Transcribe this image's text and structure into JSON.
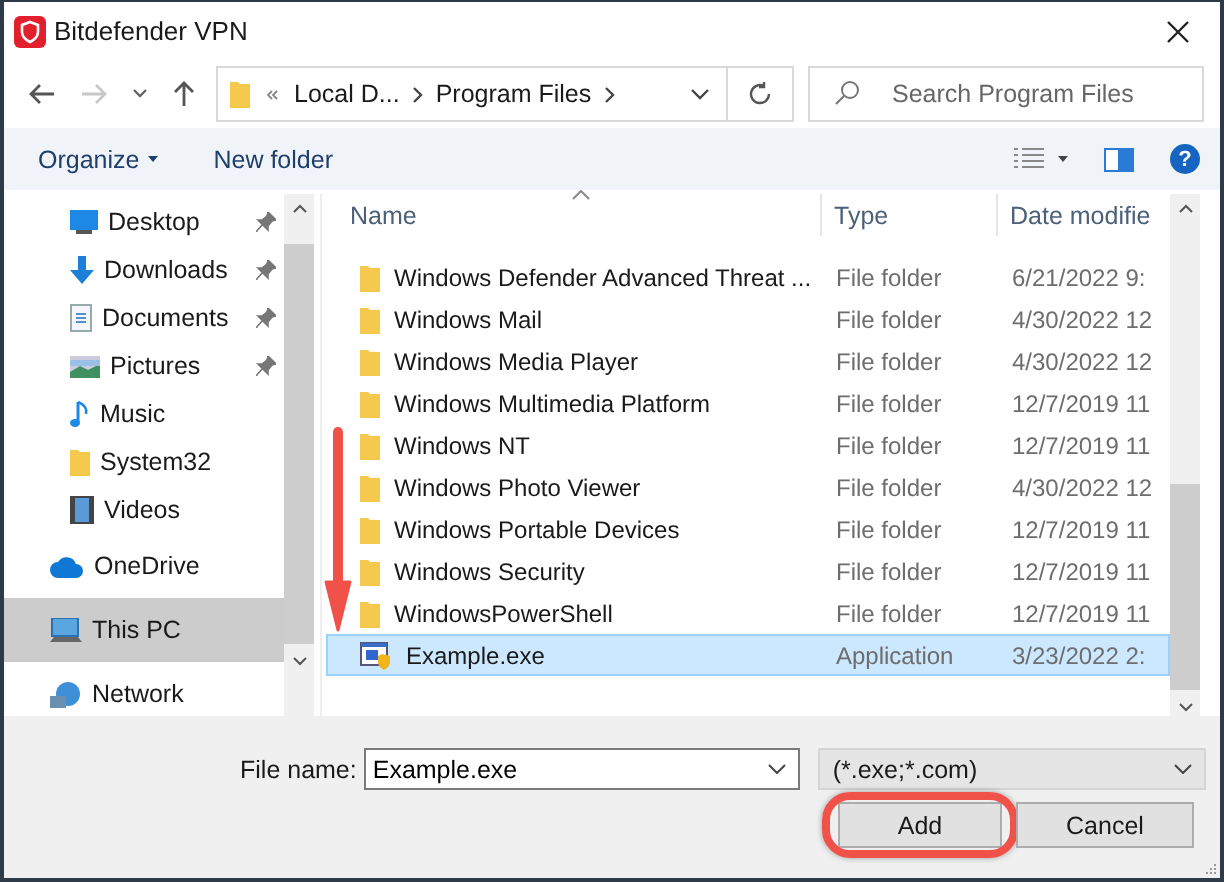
{
  "window": {
    "title": "Bitdefender VPN"
  },
  "nav": {
    "forward_disabled": true,
    "breadcrumb": [
      "Local D...",
      "Program Files"
    ],
    "search": {
      "placeholder": "Search Program Files"
    }
  },
  "toolbar": {
    "organize": "Organize",
    "new_folder": "New folder",
    "help": "?"
  },
  "sidebar": {
    "items": [
      {
        "label": "Desktop",
        "kind": "desktop",
        "pinned": true,
        "selected": false
      },
      {
        "label": "Downloads",
        "kind": "downloads",
        "pinned": true,
        "selected": false
      },
      {
        "label": "Documents",
        "kind": "documents",
        "pinned": true,
        "selected": false
      },
      {
        "label": "Pictures",
        "kind": "pictures",
        "pinned": true,
        "selected": false
      },
      {
        "label": "Music",
        "kind": "music",
        "pinned": false,
        "selected": false
      },
      {
        "label": "System32",
        "kind": "folder",
        "pinned": false,
        "selected": false
      },
      {
        "label": "Videos",
        "kind": "videos",
        "pinned": false,
        "selected": false
      }
    ],
    "locations": [
      {
        "label": "OneDrive",
        "kind": "cloud",
        "selected": false
      },
      {
        "label": "This PC",
        "kind": "pc",
        "selected": true
      },
      {
        "label": "Network",
        "kind": "network",
        "selected": false
      }
    ]
  },
  "table": {
    "columns": [
      {
        "label": "Name",
        "sorted": true
      },
      {
        "label": "Type",
        "sorted": false
      },
      {
        "label": "Date modifie",
        "sorted": false
      }
    ],
    "rows": [
      {
        "name": "Windows Defender Advanced Threat ...",
        "type": "File folder",
        "date": "6/21/2022 9:",
        "kind": "folder",
        "selected": false
      },
      {
        "name": "Windows Mail",
        "type": "File folder",
        "date": "4/30/2022 12",
        "kind": "folder",
        "selected": false
      },
      {
        "name": "Windows Media Player",
        "type": "File folder",
        "date": "4/30/2022 12",
        "kind": "folder",
        "selected": false
      },
      {
        "name": "Windows Multimedia Platform",
        "type": "File folder",
        "date": "12/7/2019 11",
        "kind": "folder",
        "selected": false
      },
      {
        "name": "Windows NT",
        "type": "File folder",
        "date": "12/7/2019 11",
        "kind": "folder",
        "selected": false
      },
      {
        "name": "Windows Photo Viewer",
        "type": "File folder",
        "date": "4/30/2022 12",
        "kind": "folder",
        "selected": false
      },
      {
        "name": "Windows Portable Devices",
        "type": "File folder",
        "date": "12/7/2019 11",
        "kind": "folder",
        "selected": false
      },
      {
        "name": "Windows Security",
        "type": "File folder",
        "date": "12/7/2019 11",
        "kind": "folder",
        "selected": false
      },
      {
        "name": "WindowsPowerShell",
        "type": "File folder",
        "date": "12/7/2019 11",
        "kind": "folder",
        "selected": false
      },
      {
        "name": "Example.exe",
        "type": "Application",
        "date": "3/23/2022 2:",
        "kind": "application",
        "selected": true
      }
    ]
  },
  "footer": {
    "file_name_label": "File name:",
    "file_name": "Example.exe",
    "filter": "(*.exe;*.com)",
    "buttons": [
      {
        "label": "Add",
        "highlighted": true
      },
      {
        "label": "Cancel",
        "highlighted": false
      }
    ]
  }
}
